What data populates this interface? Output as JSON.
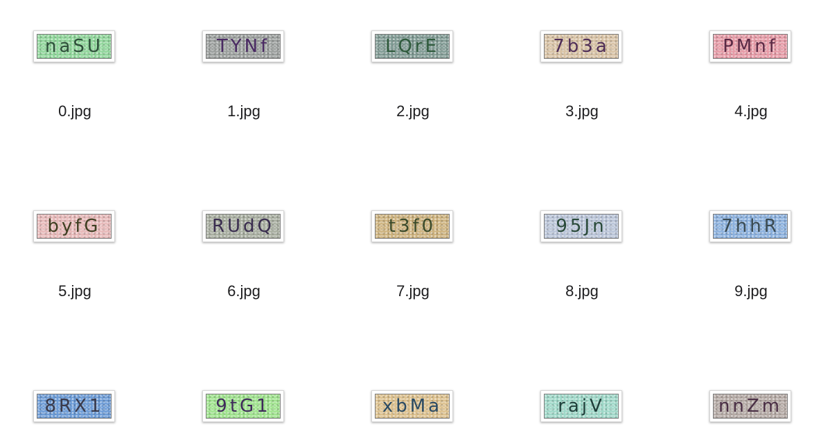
{
  "files": [
    {
      "name": "0.jpg",
      "captcha": "naSU",
      "bg": "#8fd69a",
      "ink": "#2e4f3a"
    },
    {
      "name": "1.jpg",
      "captcha": "TYNf",
      "bg": "#9a9e9c",
      "ink": "#4a2a63"
    },
    {
      "name": "2.jpg",
      "captcha": "LQrE",
      "bg": "#7f9a93",
      "ink": "#2f5a3c"
    },
    {
      "name": "3.jpg",
      "captcha": "7b3a",
      "bg": "#d8c2a4",
      "ink": "#4f2e57"
    },
    {
      "name": "4.jpg",
      "captcha": "PMnf",
      "bg": "#e69aa6",
      "ink": "#5a2a45"
    },
    {
      "name": "5.jpg",
      "captcha": "byfG",
      "bg": "#e7b8b8",
      "ink": "#3f3f22"
    },
    {
      "name": "6.jpg",
      "captcha": "RUdQ",
      "bg": "#a7ad9f",
      "ink": "#3a2d4f"
    },
    {
      "name": "7.jpg",
      "captcha": "t3f0",
      "bg": "#cdb27d",
      "ink": "#3a4a2a"
    },
    {
      "name": "8.jpg",
      "captcha": "95Jn",
      "bg": "#b9c4d8",
      "ink": "#2a4a3a"
    },
    {
      "name": "9.jpg",
      "captcha": "7hhR",
      "bg": "#8ab0de",
      "ink": "#3a4a52"
    },
    {
      "name": "",
      "captcha": "8RX1",
      "bg": "#6a9ad6",
      "ink": "#3a3a4a"
    },
    {
      "name": "",
      "captcha": "9tG1",
      "bg": "#9ee38c",
      "ink": "#3f2a5a"
    },
    {
      "name": "",
      "captcha": "xbMa",
      "bg": "#dcc08c",
      "ink": "#2a4a63"
    },
    {
      "name": "",
      "captcha": "rajV",
      "bg": "#9ed8c8",
      "ink": "#1f3f3a"
    },
    {
      "name": "",
      "captcha": "nnZm",
      "bg": "#b4a9a4",
      "ink": "#4a2f45"
    }
  ]
}
